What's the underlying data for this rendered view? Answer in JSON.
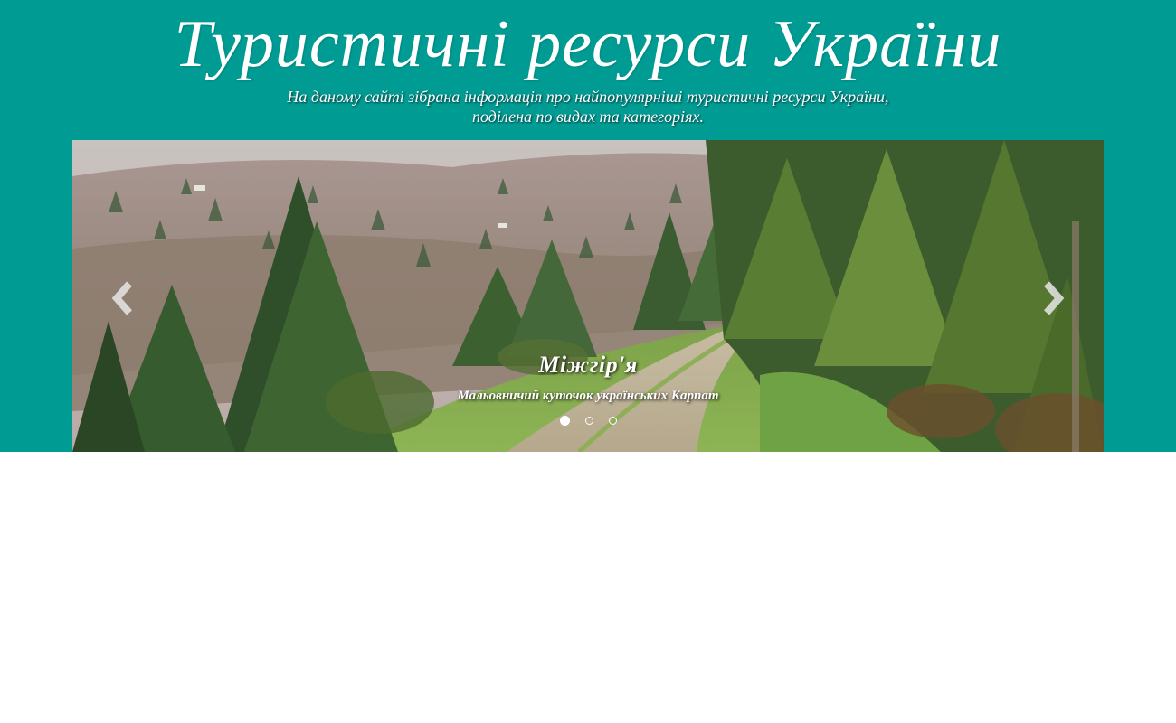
{
  "header": {
    "title": "Туристичні ресурси України",
    "description_line1": "На даному сайті зібрана інформація про найпопулярніші туристичні ресурси України,",
    "description_line2": "поділена по видах та категоріях.",
    "background_color": "#009c94"
  },
  "carousel": {
    "active_slide": {
      "title": "Міжгір'я",
      "subtitle": "Мальовничий куточок українських Карпат"
    },
    "slide_count": 3,
    "active_index": 1,
    "prev_icon": "chevron-left-icon",
    "next_icon": "chevron-right-icon"
  }
}
